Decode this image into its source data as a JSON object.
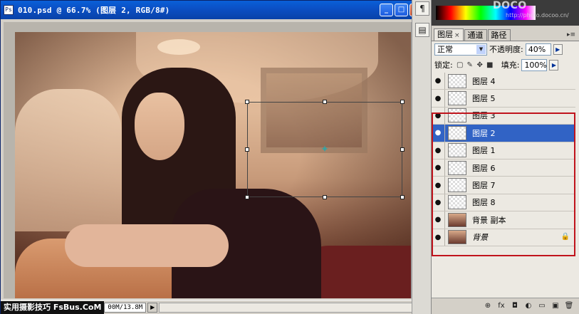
{
  "document": {
    "icon": "Ps",
    "title": "010.psd @ 66.7% (图层 2, RGB/8#)",
    "doc_size": "00M/13.8M",
    "watermark": "实用摄影技巧 FsBus.CoM",
    "status_arrow": "▶"
  },
  "window_buttons": {
    "minimize": "_",
    "maximize": "□",
    "close": "×"
  },
  "midstrip": {
    "btn1": "¶",
    "btn2": "▤"
  },
  "header_watermark": {
    "brand": "DOCO",
    "url": "http://photo.docoo.cn/"
  },
  "layers_panel": {
    "tabs": [
      {
        "label": "图层",
        "close": "×"
      },
      {
        "label": "通道"
      },
      {
        "label": "路径"
      }
    ],
    "menu_label": "▸≡",
    "blend_mode": "正常",
    "opacity_label": "不透明度:",
    "opacity_value": "40%",
    "lock_label": "锁定:",
    "fill_label": "填充:",
    "fill_value": "100%",
    "layers": [
      {
        "name": "图层 4",
        "eye": "●"
      },
      {
        "name": "图层 5",
        "eye": "●"
      },
      {
        "name": "图层 3",
        "eye": "●"
      },
      {
        "name": "图层 2",
        "eye": "●"
      },
      {
        "name": "图层 1",
        "eye": "●"
      },
      {
        "name": "图层 6",
        "eye": "●"
      },
      {
        "name": "图层 7",
        "eye": "●"
      },
      {
        "name": "图层 8",
        "eye": "●"
      },
      {
        "name": "背景 副本",
        "eye": "●"
      },
      {
        "name": "背景",
        "eye": "●",
        "lock": "🔒"
      }
    ],
    "footer_icons": [
      "⊕",
      "fx",
      "◘",
      "◐",
      "▭",
      "▣",
      "🗑"
    ]
  },
  "colors": {
    "selected_row": "#3163c5",
    "highlight_box": "#c0141c",
    "titlebar": "#0b4fc4"
  }
}
